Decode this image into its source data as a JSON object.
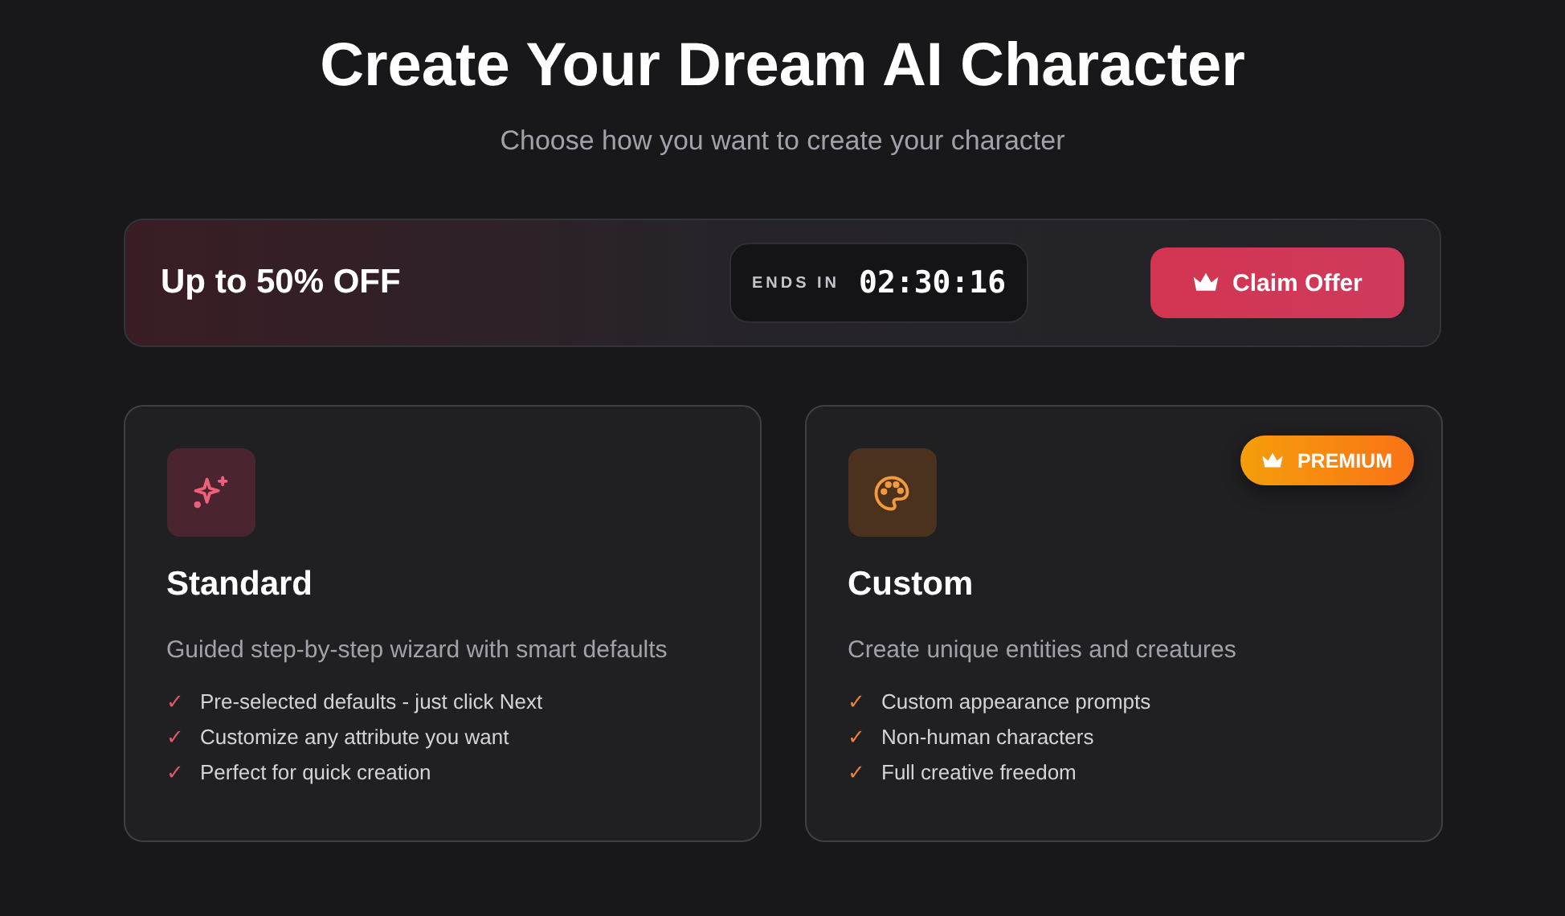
{
  "title": "Create Your Dream AI Character",
  "subtitle": "Choose how you want to create your character",
  "offer": {
    "headline": "Up to 50% OFF",
    "timer_label": "ENDS IN",
    "timer": "02:30:16",
    "button": "Claim Offer"
  },
  "cards": [
    {
      "kind": "standard",
      "title": "Standard",
      "description": "Guided step-by-step wizard with smart defaults",
      "features": [
        {
          "mark": "✓",
          "text": "Pre-selected defaults - just click Next"
        },
        {
          "mark": "✓",
          "text": "Customize any attribute you want"
        },
        {
          "mark": "✓",
          "text": "Perfect for quick creation"
        }
      ]
    },
    {
      "kind": "custom",
      "badge": "PREMIUM",
      "title": "Custom",
      "description": "Create unique entities and creatures",
      "features": [
        {
          "mark": "✓",
          "text": "Custom appearance prompts"
        },
        {
          "mark": "✓",
          "text": "Non-human characters"
        },
        {
          "mark": "✓",
          "text": "Full creative freedom"
        }
      ]
    }
  ]
}
